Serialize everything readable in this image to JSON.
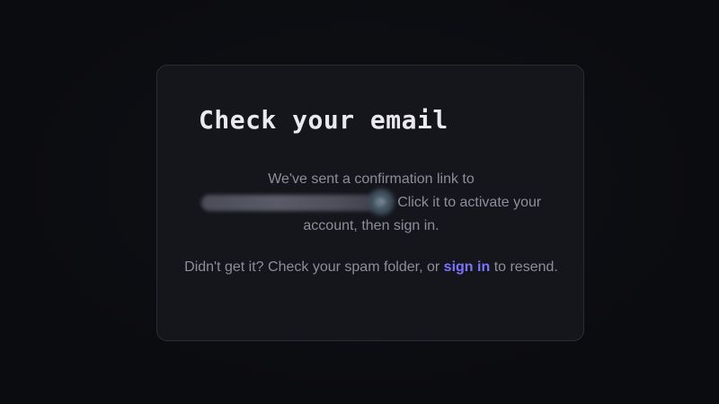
{
  "card": {
    "title": "Check your email",
    "message_part1": "We've sent a confirmation link to",
    "redacted_email_icon": "loading-spinner-icon",
    "message_part2": "Click it to activate your account, then sign in.",
    "help_prefix": "Didn't get it? Check your spam folder, or",
    "help_link": "sign in",
    "help_suffix": "to resend."
  },
  "colors": {
    "background": "#0b0c10",
    "card": "#15161c",
    "title": "#e9e9ee",
    "body_text": "#8c8e99",
    "link": "#7b74ff"
  }
}
